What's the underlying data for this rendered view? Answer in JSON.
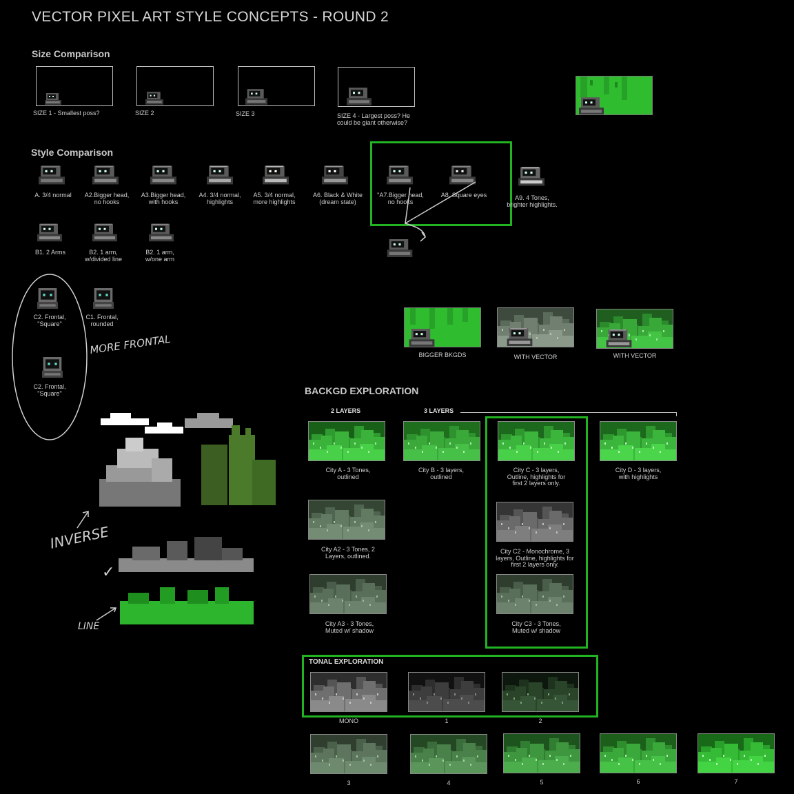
{
  "title": "VECTOR PIXEL ART STYLE CONCEPTS - ROUND 2",
  "size_comparison": {
    "heading": "Size Comparison",
    "items": [
      {
        "label": "SIZE 1 - Smallest poss?"
      },
      {
        "label": "SIZE 2"
      },
      {
        "label": "SIZE 3"
      },
      {
        "label_line1": "SIZE 4 - Largest poss?  He",
        "label_line2": "could be giant otherwise?"
      }
    ]
  },
  "style_comparison": {
    "heading": "Style Comparison",
    "row_a": [
      {
        "l1": "A. 3/4 normal",
        "l2": ""
      },
      {
        "l1": "A2.Bigger head,",
        "l2": "no hooks"
      },
      {
        "l1": "A3.Bigger head,",
        "l2": "with hooks"
      },
      {
        "l1": "A4. 3/4 normal,",
        "l2": "highlights"
      },
      {
        "l1": "A5. 3/4 normal,",
        "l2": "more highlights"
      },
      {
        "l1": "A6. Black & White",
        "l2": "(dream state)"
      },
      {
        "l1": "\"A7.Bigger head,",
        "l2": "no hooks"
      },
      {
        "l1": "A8. Square eyes",
        "l2": ""
      },
      {
        "l1": "A9. 4 Tones,",
        "l2": "brighter highlights."
      }
    ],
    "row_b": [
      {
        "l1": "B1. 2 Arms",
        "l2": ""
      },
      {
        "l1": "B2. 1 arm,",
        "l2": "w/divided line"
      },
      {
        "l1": "B2. 1 arm,",
        "l2": "w/one arm"
      }
    ],
    "row_c": [
      {
        "l1": "C2. Frontal,",
        "l2": "\"Square\""
      },
      {
        "l1": "C1. Frontal,",
        "l2": "rounded"
      },
      {
        "l1": "C2. Frontal,",
        "l2": "\"Square\""
      }
    ]
  },
  "bkgd_labels": [
    "BIGGER BKGDS",
    "WITH VECTOR",
    "WITH VECTOR"
  ],
  "annotations": {
    "more_frontal": "MORE FRONTAL",
    "inverse": "INVERSE",
    "line": "LINE",
    "check": "✓"
  },
  "backgd": {
    "heading": "BACKGD EXPLORATION",
    "two_layers": "2 LAYERS",
    "three_layers": "3 LAYERS",
    "cities": [
      {
        "l1": "City A - 3 Tones,",
        "l2": "outlined",
        "l3": ""
      },
      {
        "l1": "City B - 3 layers,",
        "l2": "outlined",
        "l3": ""
      },
      {
        "l1": "City C - 3 layers,",
        "l2": "Outline, highlights for",
        "l3": "first 2 layers only."
      },
      {
        "l1": "City D - 3 layers,",
        "l2": "with highlights",
        "l3": ""
      },
      {
        "l1": "City A2 - 3 Tones, 2",
        "l2": "Layers, outlined.",
        "l3": ""
      },
      {
        "l1": "City C2 - Monochrome, 3",
        "l2": "layers, Outline, highlights for",
        "l3": "first 2 layers only."
      },
      {
        "l1": "City A3 - 3 Tones,",
        "l2": "Muted w/ shadow",
        "l3": ""
      },
      {
        "l1": "City C3 - 3 Tones,",
        "l2": "Muted w/ shadow",
        "l3": ""
      }
    ]
  },
  "tonal": {
    "heading": "TONAL EXPLORATION",
    "labels": [
      "MONO",
      "1",
      "2",
      "3",
      "4",
      "5",
      "6",
      "7"
    ]
  },
  "colors": {
    "accent_green": "#22b322",
    "bright_green": "#2fd12f",
    "background": "#000000"
  }
}
